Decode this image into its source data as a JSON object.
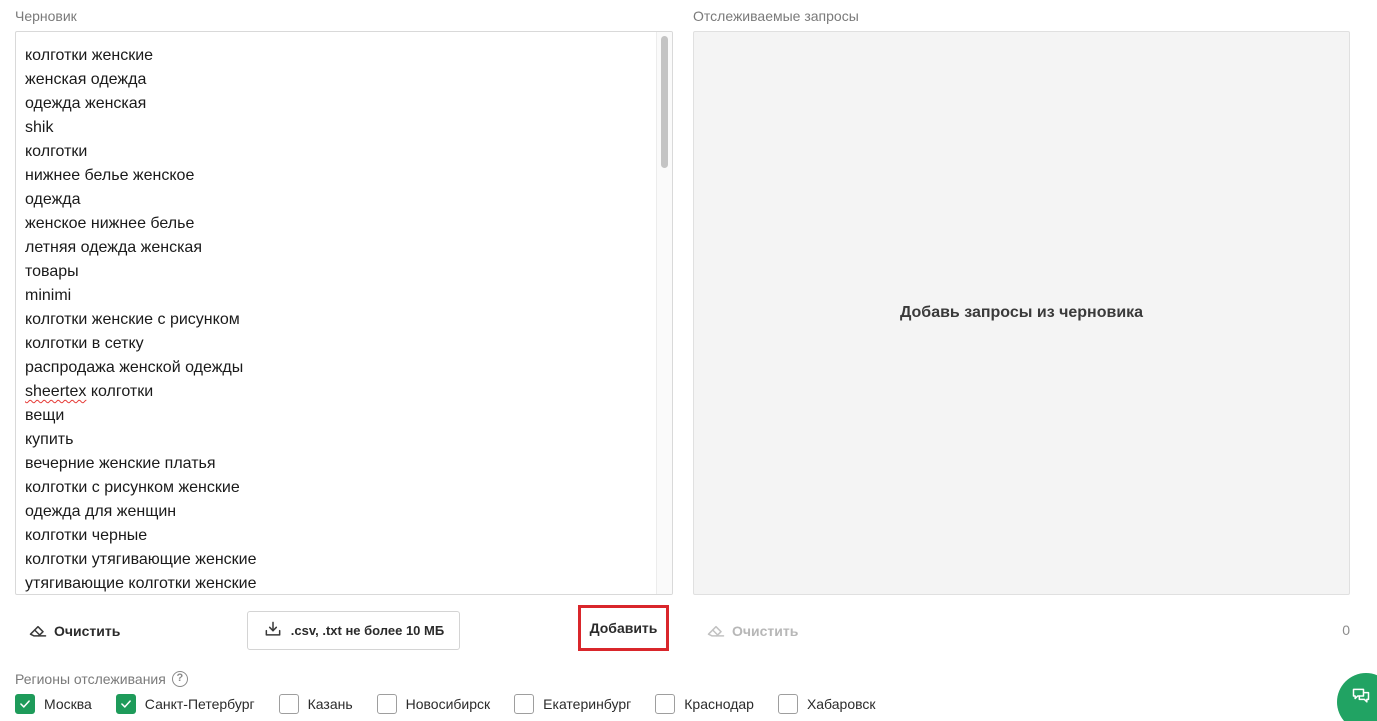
{
  "draft": {
    "label": "Черновик",
    "lines": [
      "колготки женские",
      "женская одежда",
      "одежда женская",
      "shik",
      "колготки",
      "нижнее белье женское",
      "одежда",
      "женское нижнее белье",
      "летняя одежда женская",
      "товары",
      "minimi",
      "колготки женские с рисунком",
      "колготки в сетку",
      "распродажа женской одежды",
      "sheertex",
      "вещи",
      "купить",
      "вечерние женские платья",
      "колготки с рисунком женские",
      "одежда для женщин",
      "колготки черные",
      "колготки утягивающие женские",
      "утягивающие колготки женские"
    ],
    "line15_tail": " колготки",
    "clear_label": "Очистить",
    "upload_label": ".csv, .txt не более 10 МБ",
    "add_label": "Добавить"
  },
  "tracked": {
    "label": "Отслеживаемые запросы",
    "empty_text": "Добавь запросы из черновика",
    "clear_label": "Очистить",
    "count": "0"
  },
  "regions": {
    "label": "Регионы отслеживания",
    "help_glyph": "?",
    "items": [
      {
        "name": "Москва",
        "checked": true
      },
      {
        "name": "Санкт-Петербург",
        "checked": true
      },
      {
        "name": "Казань",
        "checked": false
      },
      {
        "name": "Новосибирск",
        "checked": false
      },
      {
        "name": "Екатеринбург",
        "checked": false
      },
      {
        "name": "Краснодар",
        "checked": false
      },
      {
        "name": "Хабаровск",
        "checked": false
      }
    ]
  },
  "colors": {
    "accent_green": "#1e9b5a",
    "highlight_red": "#d9262b"
  },
  "icons": {
    "clear": "eraser-icon",
    "upload": "download-tray-icon",
    "help": "question-circle-icon",
    "checkbox": "check-icon",
    "chat": "chat-bubbles-icon"
  }
}
